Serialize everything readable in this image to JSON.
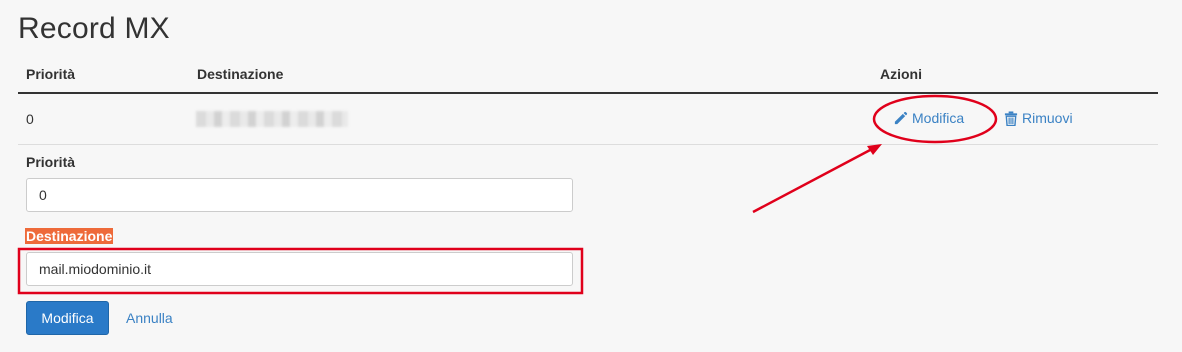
{
  "page": {
    "title": "Record MX"
  },
  "table": {
    "headers": {
      "priority": "Priorità",
      "destination": "Destinazione",
      "actions": "Azioni"
    },
    "rows": [
      {
        "priority": "0",
        "actions": {
          "edit": "Modifica",
          "remove": "Rimuovi"
        }
      }
    ]
  },
  "edit_form": {
    "priority_label": "Priorità",
    "priority_value": "0",
    "destination_label": "Destinazione",
    "destination_value": "mail.miodominio.it",
    "submit_label": "Modifica",
    "cancel_label": "Annulla"
  },
  "colors": {
    "link": "#3b82c4",
    "primary_button": "#2a7ac8",
    "annotation": "#e0001b",
    "label_highlight": "#ee6a3a"
  },
  "icons": {
    "edit": "pencil-icon",
    "remove": "trash-icon"
  }
}
